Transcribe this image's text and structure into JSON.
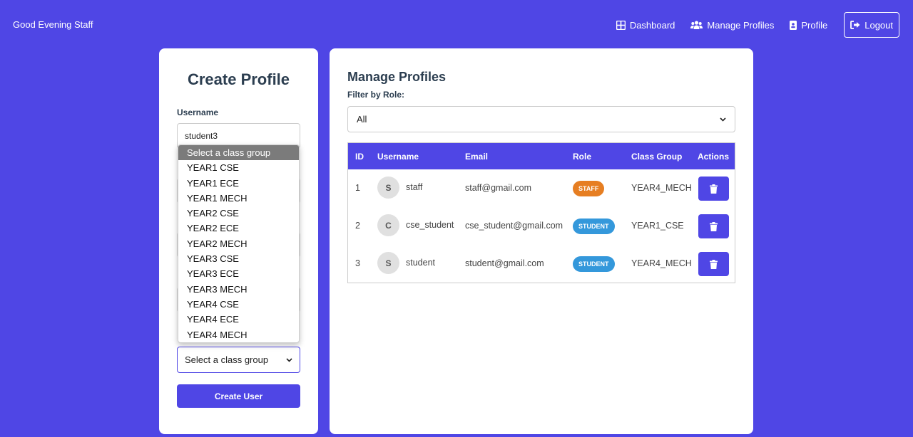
{
  "header": {
    "greeting": "Good Evening Staff",
    "nav": {
      "dashboard": "Dashboard",
      "manage_profiles": "Manage Profiles",
      "profile": "Profile",
      "logout": "Logout"
    }
  },
  "create_profile": {
    "title": "Create Profile",
    "username_label": "Username",
    "username_value": "student3",
    "class_group_selected": "Select a class group",
    "class_group_options": [
      "Select a class group",
      "YEAR1 CSE",
      "YEAR1 ECE",
      "YEAR1 MECH",
      "YEAR2 CSE",
      "YEAR2 ECE",
      "YEAR2 MECH",
      "YEAR3 CSE",
      "YEAR3 ECE",
      "YEAR3 MECH",
      "YEAR4 CSE",
      "YEAR4 ECE",
      "YEAR4 MECH"
    ],
    "submit_label": "Create User"
  },
  "manage_profiles": {
    "title": "Manage Profiles",
    "filter_label": "Filter by Role:",
    "filter_value": "All",
    "columns": [
      "ID",
      "Username",
      "Email",
      "Role",
      "Class Group",
      "Actions"
    ],
    "rows": [
      {
        "id": "1",
        "initial": "S",
        "username": "staff",
        "email": "staff@gmail.com",
        "role": "STAFF",
        "class_group": "YEAR4_MECH"
      },
      {
        "id": "2",
        "initial": "C",
        "username": "cse_student",
        "email": "cse_student@gmail.com",
        "role": "STUDENT",
        "class_group": "YEAR1_CSE"
      },
      {
        "id": "3",
        "initial": "S",
        "username": "student",
        "email": "student@gmail.com",
        "role": "STUDENT",
        "class_group": "YEAR4_MECH"
      }
    ]
  },
  "colors": {
    "primary": "#4f46e5",
    "staff_badge": "#e67e22",
    "student_badge": "#3498db"
  }
}
